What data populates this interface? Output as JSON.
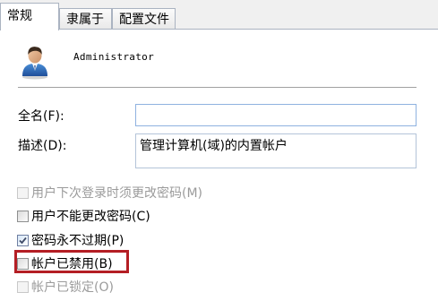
{
  "tabs": [
    {
      "label": "常规",
      "active": true
    },
    {
      "label": "隶属于",
      "active": false
    },
    {
      "label": "配置文件",
      "active": false
    }
  ],
  "user": {
    "icon": "user-icon",
    "name": "Administrator"
  },
  "form": {
    "full_name_label": "全名(F):",
    "full_name_value": "",
    "description_label": "描述(D):",
    "description_value": "管理计算机(域)的内置帐户"
  },
  "options": [
    {
      "label": "用户下次登录时须更改密码(M)",
      "checked": false,
      "enabled": false
    },
    {
      "label": "用户不能更改密码(C)",
      "checked": false,
      "enabled": true
    },
    {
      "label": "密码永不过期(P)",
      "checked": true,
      "enabled": true
    },
    {
      "label": "帐户已禁用(B)",
      "checked": false,
      "enabled": true,
      "highlighted": true
    },
    {
      "label": "帐户已锁定(O)",
      "checked": false,
      "enabled": false
    }
  ],
  "colors": {
    "highlight": "#b41e24",
    "tab_border": "#aab3c1"
  }
}
